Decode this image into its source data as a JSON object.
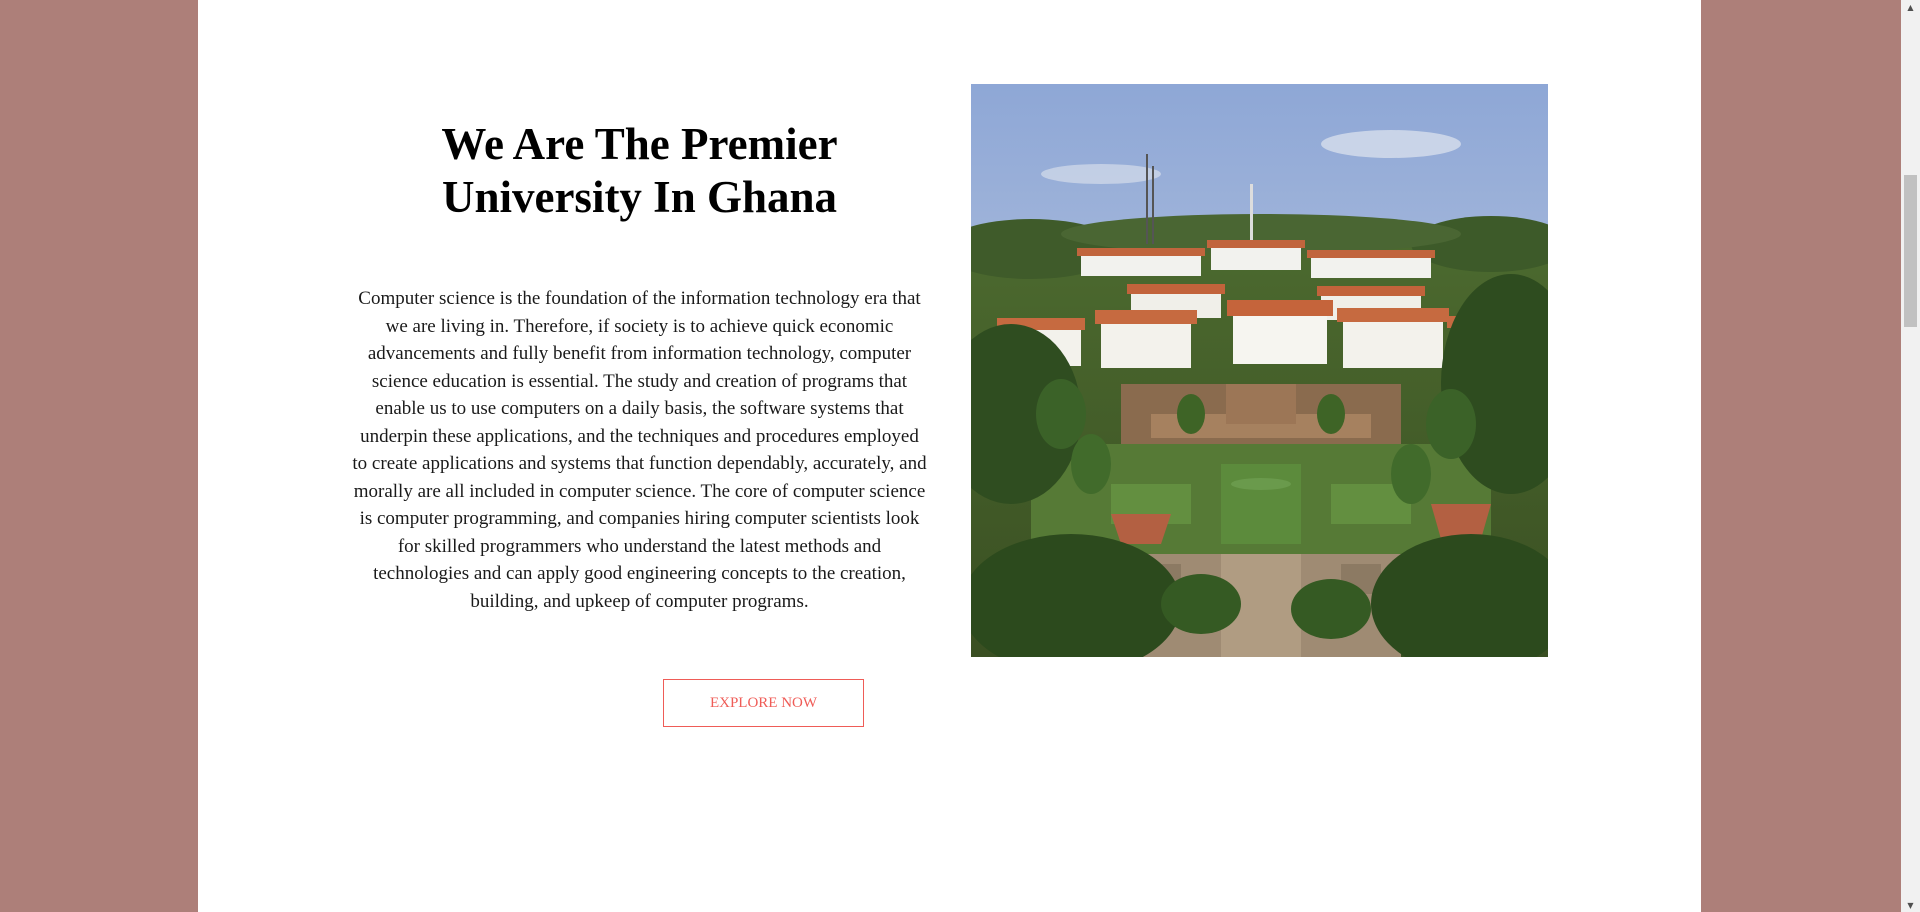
{
  "hero": {
    "title_line1": "We Are The Premier",
    "title_line2": "University In Ghana",
    "body": "Computer science is the foundation of the information technology era that we are living in. Therefore, if society is to achieve quick economic advancements and fully benefit from information technology, computer science education is essential. The study and creation of programs that enable us to use computers on a daily basis, the software systems that underpin these applications, and the techniques and procedures employed to create applications and systems that function dependably, accurately, and morally are all included in computer science. The core of computer science is computer programming, and companies hiring computer scientists look for skilled programmers who understand the latest methods and technologies and can apply good engineering concepts to the creation, building, and upkeep of computer programs.",
    "cta_label": "EXPLORE NOW"
  },
  "colors": {
    "page_background": "#ad7f79",
    "content_background": "#ffffff",
    "accent": "#ef5c57"
  },
  "icons": {
    "scroll_up": "triangle-up-icon",
    "scroll_down": "triangle-down-icon"
  }
}
